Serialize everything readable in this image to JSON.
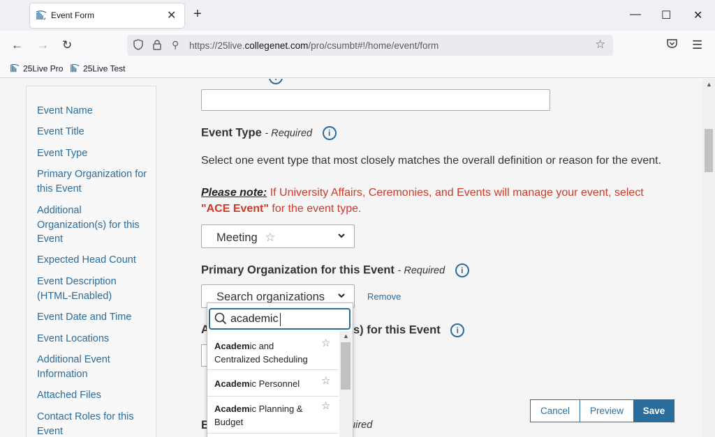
{
  "browser": {
    "tab_title": "Event Form",
    "url_domain": "https://25live.",
    "url_host": "collegenet.com",
    "url_path": "/pro/csumbt#!/home/event/form",
    "bookmarks": [
      "25Live Pro",
      "25Live Test"
    ]
  },
  "sidenav": {
    "items": [
      "Event Name",
      "Event Title",
      "Event Type",
      "Primary Organization for this Event",
      "Additional Organization(s) for this Event",
      "Expected Head Count",
      "Event Description (HTML-Enabled)",
      "Event Date and Time",
      "Event Locations",
      "Additional Event Information",
      "Attached Files",
      "Contact Roles for this Event"
    ]
  },
  "form": {
    "event_type_label": "Event Type",
    "required_text": "- Required",
    "description": "Select one event type that most closely matches the overall definition or reason for the event.",
    "please_note": "Please note:",
    "note_text_1": " If University Affairs, Ceremonies, and Events will manage your event, select ",
    "ace_event": "\"ACE Event\"",
    "note_text_2": " for the event type.",
    "event_type_value": "Meeting",
    "primary_org_label": "Primary Organization for this Event",
    "primary_org_required": "- Required",
    "search_orgs_placeholder": "Search organizations",
    "remove_link": "Remove",
    "additional_org_partial": "s) for this Event",
    "partial_required": "quired"
  },
  "dropdown": {
    "query": "academic",
    "options": [
      {
        "match": "Academ",
        "rest": "ic and Centralized Scheduling"
      },
      {
        "match": "Academ",
        "rest": "ic Personnel"
      },
      {
        "match": "Academ",
        "rest": "ic Planning & Budget"
      }
    ]
  },
  "actions": {
    "cancel": "Cancel",
    "preview": "Preview",
    "save": "Save"
  },
  "colors": {
    "link": "#2a6c9c",
    "note_red": "#cc3a2a",
    "primary_button": "#2a6c9c"
  }
}
